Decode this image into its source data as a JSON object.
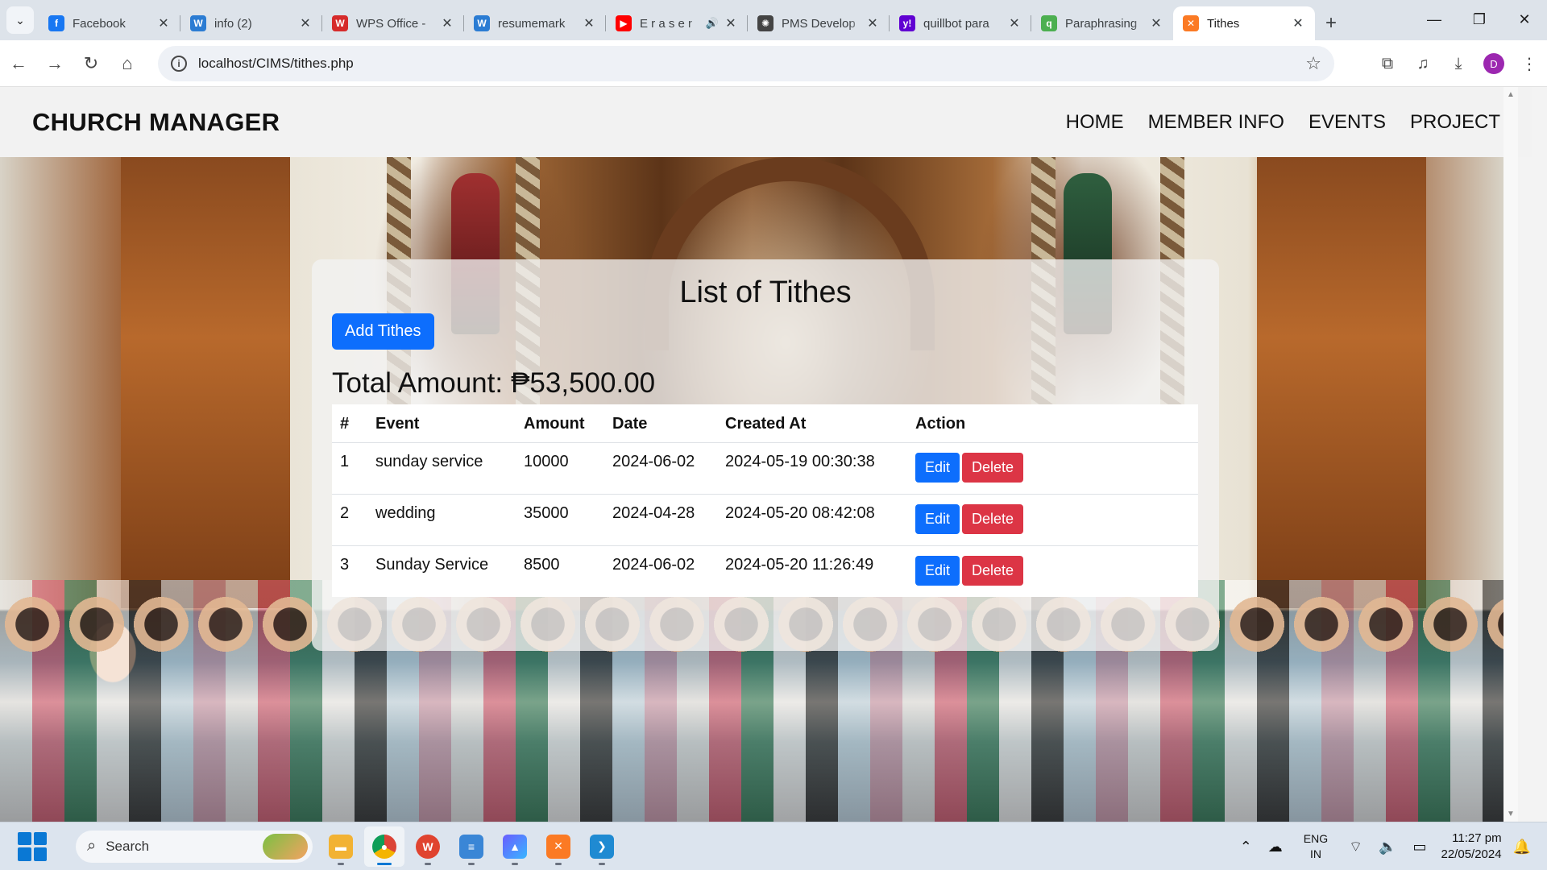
{
  "browser": {
    "tabs": [
      {
        "title": "Facebook",
        "icon": "facebook-icon",
        "color": "#1877f2",
        "glyph": "f"
      },
      {
        "title": "info (2)",
        "icon": "word-icon",
        "color": "#2b7cd3",
        "glyph": "W"
      },
      {
        "title": "WPS Office -",
        "icon": "wps-icon",
        "color": "#d62b2b",
        "glyph": "W"
      },
      {
        "title": "resumemark",
        "icon": "word-icon",
        "color": "#2b7cd3",
        "glyph": "W"
      },
      {
        "title": "E r a s e r",
        "icon": "youtube-icon",
        "color": "#ff0000",
        "glyph": "▶",
        "audio": "🔊"
      },
      {
        "title": "PMS Develop",
        "icon": "openai-icon",
        "color": "#444444",
        "glyph": "✺"
      },
      {
        "title": "quillbot para",
        "icon": "yahoo-icon",
        "color": "#6001d2",
        "glyph": "y!"
      },
      {
        "title": "Paraphrasing",
        "icon": "quillbot-icon",
        "color": "#4caf50",
        "glyph": "q"
      },
      {
        "title": "Tithes",
        "icon": "xampp-icon",
        "color": "#fb7a24",
        "glyph": "✕",
        "active": true
      }
    ],
    "close_glyph": "✕",
    "new_tab_glyph": "+",
    "url": "localhost/CIMS/tithes.php",
    "profile_initial": "D"
  },
  "site": {
    "brand": "CHURCH MANAGER",
    "nav": [
      "HOME",
      "MEMBER INFO",
      "EVENTS",
      "PROJECT"
    ]
  },
  "tithes": {
    "title": "List of Tithes",
    "add_button": "Add Tithes",
    "total_label": "Total Amount:",
    "total_value": "₱53,500.00",
    "columns": [
      "#",
      "Event",
      "Amount",
      "Date",
      "Created At",
      "Action"
    ],
    "rows": [
      {
        "no": "1",
        "event": "sunday service",
        "amount": "10000",
        "date": "2024-06-02",
        "created": "2024-05-19 00:30:38"
      },
      {
        "no": "2",
        "event": "wedding",
        "amount": "35000",
        "date": "2024-04-28",
        "created": "2024-05-20 08:42:08"
      },
      {
        "no": "3",
        "event": "Sunday Service",
        "amount": "8500",
        "date": "2024-06-02",
        "created": "2024-05-20 11:26:49"
      }
    ],
    "edit_label": "Edit",
    "delete_label": "Delete"
  },
  "taskbar": {
    "search_placeholder": "Search",
    "lang_top": "ENG",
    "lang_bottom": "IN",
    "time": "11:27 pm",
    "date": "22/05/2024"
  },
  "colors": {
    "primary": "#0d6efd",
    "danger": "#dc3545"
  }
}
